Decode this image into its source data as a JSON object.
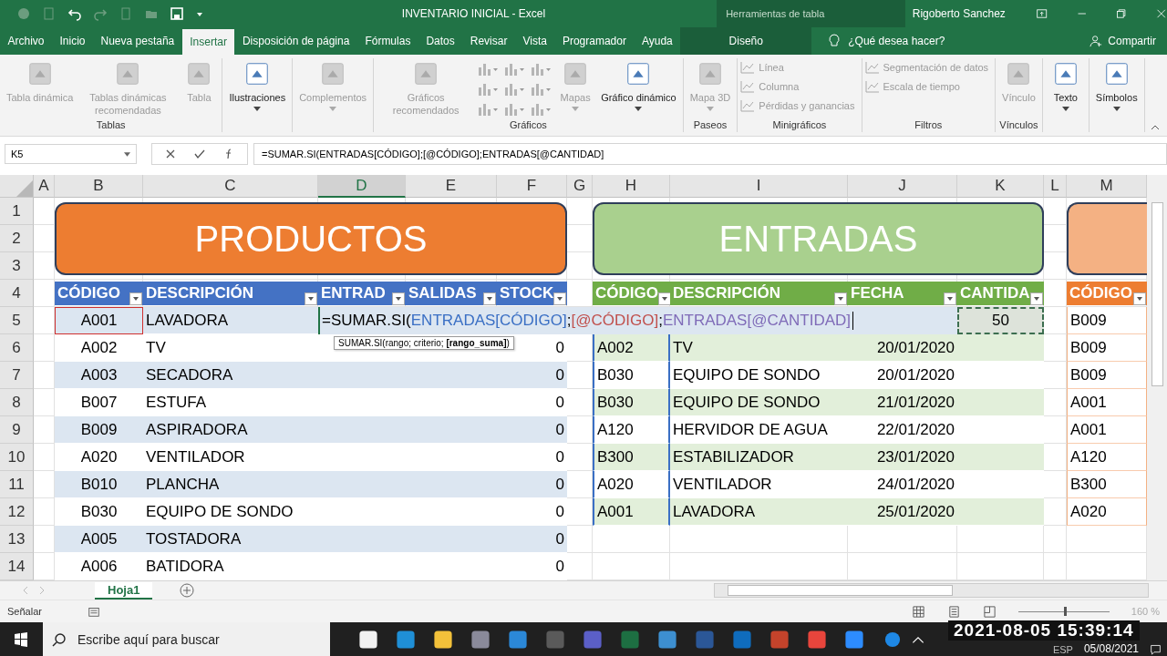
{
  "title_bar": {
    "title": "INVENTARIO INICIAL  -  Excel",
    "context_group": "Herramientas de tabla",
    "user": "Rigoberto Sanchez"
  },
  "tabs": [
    {
      "label": "Archivo",
      "selected": false,
      "contextual": false
    },
    {
      "label": "Inicio",
      "selected": false,
      "contextual": false
    },
    {
      "label": "Nueva pestaña",
      "selected": false,
      "contextual": false
    },
    {
      "label": "Insertar",
      "selected": true,
      "contextual": false
    },
    {
      "label": "Disposición de página",
      "selected": false,
      "contextual": false
    },
    {
      "label": "Fórmulas",
      "selected": false,
      "contextual": false
    },
    {
      "label": "Datos",
      "selected": false,
      "contextual": false
    },
    {
      "label": "Revisar",
      "selected": false,
      "contextual": false
    },
    {
      "label": "Vista",
      "selected": false,
      "contextual": false
    },
    {
      "label": "Programador",
      "selected": false,
      "contextual": false
    },
    {
      "label": "Ayuda",
      "selected": false,
      "contextual": false
    },
    {
      "label": "Diseño",
      "selected": false,
      "contextual": true
    }
  ],
  "tell_me": "¿Qué desea hacer?",
  "share": "Compartir",
  "ribbon": [
    {
      "label": "Tablas",
      "items": [
        {
          "kind": "large",
          "label": "Tabla dinámica",
          "disabled": true,
          "dropdown": false
        },
        {
          "kind": "large",
          "label": "Tablas dinámicas recomendadas",
          "disabled": true,
          "dropdown": false
        },
        {
          "kind": "large",
          "label": "Tabla",
          "disabled": true,
          "dropdown": false
        }
      ]
    },
    {
      "items": [
        {
          "kind": "large",
          "label": "Ilustraciones",
          "disabled": false,
          "dropdown": true
        }
      ]
    },
    {
      "items": [
        {
          "kind": "large",
          "label": "Complementos",
          "disabled": true,
          "dropdown": true
        }
      ]
    },
    {
      "label": "Gráficos",
      "items": [
        {
          "kind": "large",
          "label": "Gráficos recomendados",
          "disabled": true,
          "dropdown": false
        },
        {
          "kind": "icons",
          "disabled": true
        },
        {
          "kind": "large",
          "label": "Mapas",
          "disabled": true,
          "dropdown": true
        },
        {
          "kind": "large",
          "label": "Gráfico dinámico",
          "disabled": false,
          "dropdown": true
        }
      ]
    },
    {
      "label": "Paseos",
      "items": [
        {
          "kind": "large",
          "label": "Mapa 3D",
          "disabled": true,
          "dropdown": true
        }
      ]
    },
    {
      "label": "Minigráficos",
      "items": [
        {
          "kind": "small",
          "label": "Línea",
          "disabled": true
        },
        {
          "kind": "small",
          "label": "Columna",
          "disabled": true
        },
        {
          "kind": "small",
          "label": "Pérdidas y ganancias",
          "disabled": true
        }
      ]
    },
    {
      "label": "Filtros",
      "items": [
        {
          "kind": "small",
          "label": "Segmentación de datos",
          "disabled": true
        },
        {
          "kind": "small",
          "label": "Escala de tiempo",
          "disabled": true
        }
      ]
    },
    {
      "label": "Vínculos",
      "items": [
        {
          "kind": "large",
          "label": "Vínculo",
          "disabled": true,
          "dropdown": false
        }
      ]
    },
    {
      "items": [
        {
          "kind": "large",
          "label": "Texto",
          "disabled": false,
          "dropdown": true
        }
      ]
    },
    {
      "items": [
        {
          "kind": "large",
          "label": "Símbolos",
          "disabled": false,
          "dropdown": true
        }
      ]
    }
  ],
  "formula_bar": {
    "name_box": "K5",
    "formula": "=SUMAR.SI(ENTRADAS[CÓDIGO];[@CÓDIGO];ENTRADAS[@CANTIDAD]"
  },
  "columns": [
    {
      "label": "A",
      "selected": false
    },
    {
      "label": "B",
      "selected": false
    },
    {
      "label": "C",
      "selected": false
    },
    {
      "label": "D",
      "selected": true
    },
    {
      "label": "E",
      "selected": false
    },
    {
      "label": "F",
      "selected": false
    },
    {
      "label": "G",
      "selected": false
    },
    {
      "label": "H",
      "selected": false
    },
    {
      "label": "I",
      "selected": false
    },
    {
      "label": "J",
      "selected": false
    },
    {
      "label": "K",
      "selected": false
    },
    {
      "label": "L",
      "selected": false
    },
    {
      "label": "M",
      "selected": false
    }
  ],
  "rows": [
    "1",
    "2",
    "3",
    "4",
    "5",
    "6",
    "7",
    "8",
    "9",
    "10",
    "11",
    "12",
    "13",
    "14"
  ],
  "banners": [
    {
      "text": "PRODUCTOS",
      "color": "#ed7d31"
    },
    {
      "text": "ENTRADAS",
      "color": "#a9d08e"
    },
    {
      "color": "#f4b183"
    }
  ],
  "productos": {
    "headers": [
      "CÓDIGO",
      "DESCRIPCIÓN",
      "ENTRAD",
      "SALIDAS",
      "STOCK"
    ],
    "rows": [
      {
        "codigo": "A001",
        "descripcion": "LAVADORA"
      },
      {
        "codigo": "A002",
        "descripcion": "TV",
        "stock": "0"
      },
      {
        "codigo": "A003",
        "descripcion": "SECADORA",
        "stock": "0"
      },
      {
        "codigo": "B007",
        "descripcion": "ESTUFA",
        "stock": "0"
      },
      {
        "codigo": "B009",
        "descripcion": "ASPIRADORA",
        "stock": "0"
      },
      {
        "codigo": "A020",
        "descripcion": "VENTILADOR",
        "stock": "0"
      },
      {
        "codigo": "B010",
        "descripcion": "PLANCHA",
        "stock": "0"
      },
      {
        "codigo": "B030",
        "descripcion": "EQUIPO DE SONDO",
        "stock": "0"
      },
      {
        "codigo": "A005",
        "descripcion": "TOSTADORA",
        "stock": "0"
      },
      {
        "codigo": "A006",
        "descripcion": "BATIDORA",
        "stock": "0"
      }
    ]
  },
  "formula_parts": [
    {
      "text": "=SUMAR.SI("
    },
    {
      "text": "ENTRADAS[CÓDIGO]",
      "color": "#3a6fc4"
    },
    {
      "text": ";"
    },
    {
      "text": "[@CÓDIGO]",
      "color": "#c0504d"
    },
    {
      "text": ";"
    },
    {
      "text": "ENTRADAS[@CANTIDAD]",
      "color": "#7f6bb8"
    }
  ],
  "tooltip": "SUMAR.SI(rango; criterio; **[rango_suma]**)",
  "entradas": {
    "headers": [
      "CÓDIGO",
      "DESCRIPCIÓN",
      "FECHA",
      "CANTIDA"
    ],
    "active_value": "50",
    "rows": [
      {
        "codigo": "A002",
        "descripcion": "TV",
        "fecha": "20/01/2020"
      },
      {
        "codigo": "B030",
        "descripcion": "EQUIPO DE SONDO",
        "fecha": "20/01/2020"
      },
      {
        "codigo": "B030",
        "descripcion": "EQUIPO DE SONDO",
        "fecha": "21/01/2020"
      },
      {
        "codigo": "A120",
        "descripcion": "HERVIDOR DE AGUA",
        "fecha": "22/01/2020"
      },
      {
        "codigo": "B300",
        "descripcion": "ESTABILIZADOR",
        "fecha": "23/01/2020"
      },
      {
        "codigo": "A020",
        "descripcion": "VENTILADOR",
        "fecha": "24/01/2020"
      },
      {
        "codigo": "A001",
        "descripcion": "LAVADORA",
        "fecha": "25/01/2020"
      }
    ]
  },
  "salidas": {
    "header": "CÓDIGO",
    "rows": [
      "B009",
      "B009",
      "B009",
      "A001",
      "A001",
      "A120",
      "B300",
      "A020"
    ]
  },
  "sheet_tabs": [
    {
      "label": "Hoja1",
      "selected": true
    }
  ],
  "status_bar": {
    "mode": "Señalar",
    "zoom": "160 %",
    "zoom_slider": {
      "level": 0.5
    }
  },
  "taskbar": {
    "search_placeholder": "Escribe aquí para buscar",
    "language": "ESP",
    "date": "05/08/2021"
  },
  "recording_timestamp": "2021-08-05 15:39:14"
}
